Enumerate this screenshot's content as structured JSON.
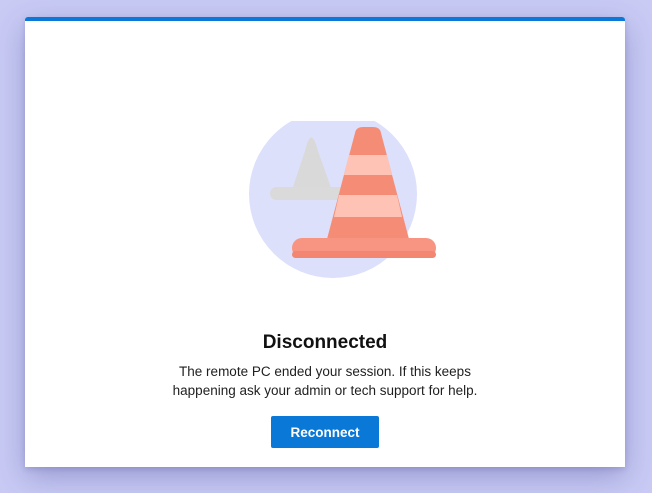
{
  "dialog": {
    "title": "Disconnected",
    "message_line1": "The remote PC ended your session. If this keeps",
    "message_line2": "happening ask your admin or tech support for help.",
    "reconnect_label": "Reconnect"
  },
  "illustration": {
    "icon": "traffic-cone-icon",
    "accent_color": "#0a78d7",
    "circle_color": "#dde0fb",
    "cone_color": "#f58d76",
    "cone_stripe_color": "#ffc3b5",
    "shadow_cone_color": "#d8d8d8"
  }
}
